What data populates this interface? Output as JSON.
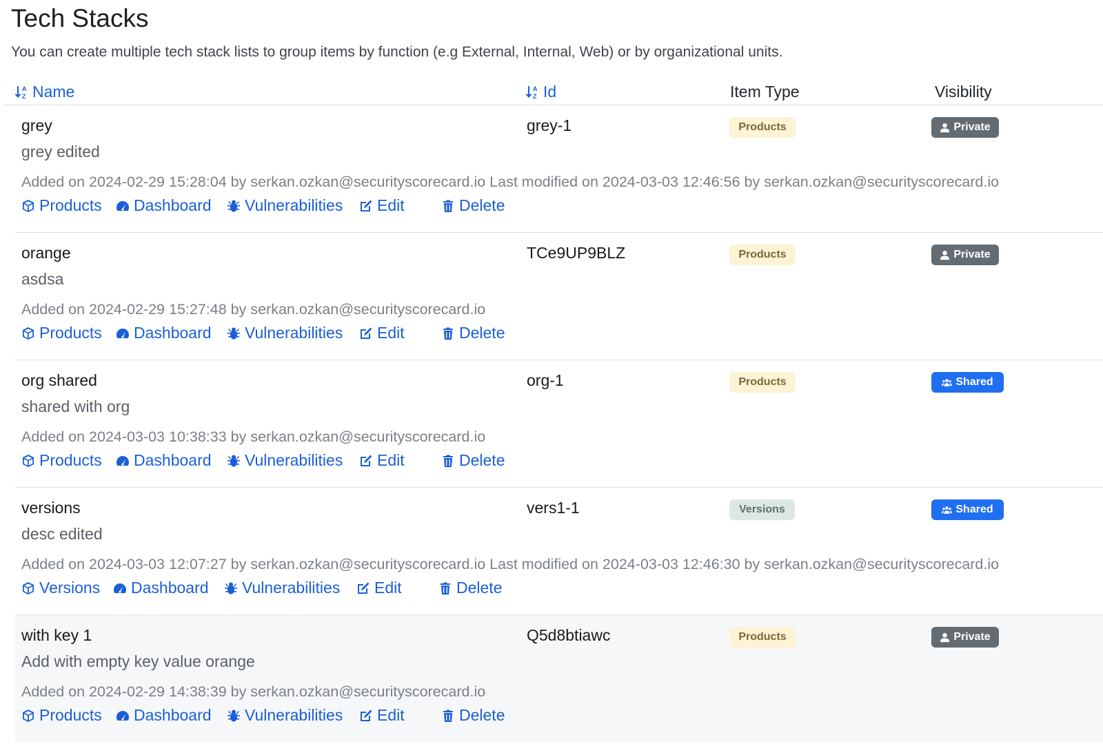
{
  "page": {
    "title": "Tech Stacks",
    "subtitle": "You can create multiple tech stack lists to group items by function (e.g External, Internal, Web) or by organizational units."
  },
  "table": {
    "columns": {
      "name": "Name",
      "id": "Id",
      "item_type": "Item Type",
      "visibility": "Visibility"
    },
    "rows": [
      {
        "name": "grey",
        "description": "grey edited",
        "meta": "Added on 2024-02-29 15:28:04 by serkan.ozkan@securityscorecard.io Last modified on 2024-03-03 12:46:56 by serkan.ozkan@securityscorecard.io",
        "id": "grey-1",
        "item_type": "Products",
        "visibility": "Private",
        "actions": {
          "items": "Products",
          "dashboard": "Dashboard",
          "vulnerabilities": "Vulnerabilities",
          "edit": "Edit",
          "delete": "Delete"
        }
      },
      {
        "name": "orange",
        "description": "asdsa",
        "meta": "Added on 2024-02-29 15:27:48 by serkan.ozkan@securityscorecard.io",
        "id": "TCe9UP9BLZ",
        "item_type": "Products",
        "visibility": "Private",
        "actions": {
          "items": "Products",
          "dashboard": "Dashboard",
          "vulnerabilities": "Vulnerabilities",
          "edit": "Edit",
          "delete": "Delete"
        }
      },
      {
        "name": "org shared",
        "description": "shared with org",
        "meta": "Added on 2024-03-03 10:38:33 by serkan.ozkan@securityscorecard.io",
        "id": "org-1",
        "item_type": "Products",
        "visibility": "Shared",
        "actions": {
          "items": "Products",
          "dashboard": "Dashboard",
          "vulnerabilities": "Vulnerabilities",
          "edit": "Edit",
          "delete": "Delete"
        }
      },
      {
        "name": "versions",
        "description": "desc edited",
        "meta": "Added on 2024-03-03 12:07:27 by serkan.ozkan@securityscorecard.io Last modified on 2024-03-03 12:46:30 by serkan.ozkan@securityscorecard.io",
        "id": "vers1-1",
        "item_type": "Versions",
        "visibility": "Shared",
        "actions": {
          "items": "Versions",
          "dashboard": "Dashboard",
          "vulnerabilities": "Vulnerabilities",
          "edit": "Edit",
          "delete": "Delete"
        }
      },
      {
        "name": "with key 1",
        "description": "Add with empty key value orange",
        "meta": "Added on 2024-02-29 14:38:39 by serkan.ozkan@securityscorecard.io",
        "id": "Q5d8btiawc",
        "item_type": "Products",
        "visibility": "Private",
        "actions": {
          "items": "Products",
          "dashboard": "Dashboard",
          "vulnerabilities": "Vulnerabilities",
          "edit": "Edit",
          "delete": "Delete"
        }
      }
    ]
  },
  "colors": {
    "link": "#1a5fd6",
    "badge_products_bg": "#fdf3d5",
    "badge_versions_bg": "#dde8e3",
    "badge_private_bg": "#636b73",
    "badge_shared_bg": "#1f6ff0"
  },
  "icons": {
    "sort": "sort-alpha-down-icon",
    "items": "box-icon",
    "dashboard": "speedometer-icon",
    "vulnerabilities": "bug-icon",
    "edit": "edit-icon",
    "delete": "trash-icon",
    "private": "user-icon",
    "shared": "users-icon"
  }
}
